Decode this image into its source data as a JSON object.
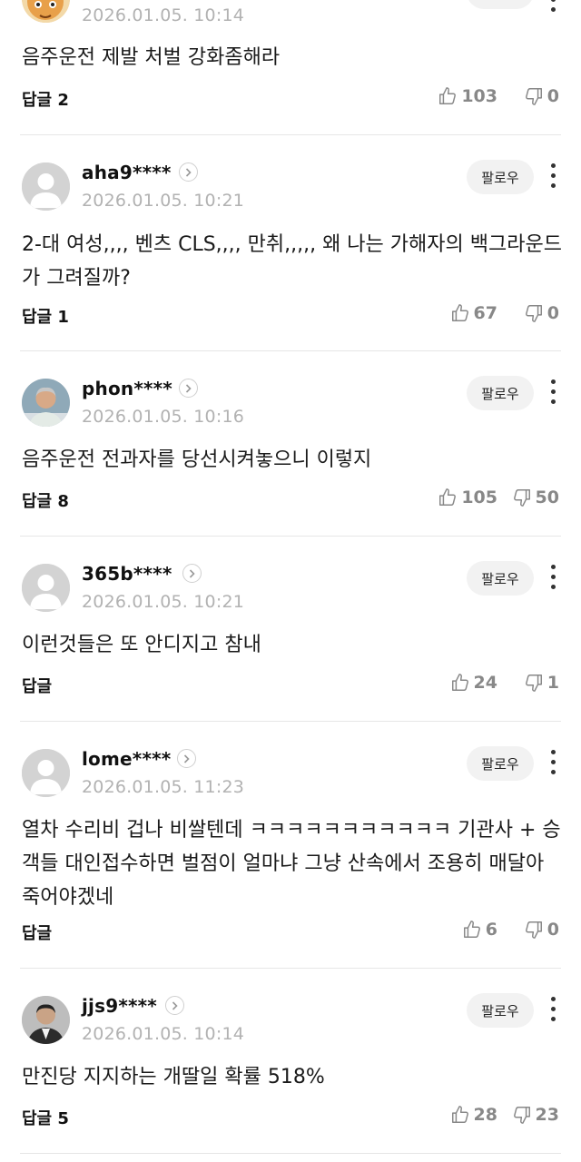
{
  "comments": [
    {
      "username": "",
      "timestamp": "2026.01.05. 10:14",
      "text": "음주운전 제발 처벌 강화좀해라",
      "reply_label": "답글 2",
      "likes": "103",
      "dislikes": "0",
      "follow_label": "",
      "avatar": "cartoon-character"
    },
    {
      "username": "aha9****",
      "timestamp": "2026.01.05. 10:21",
      "text": "2-대 여성,,,, 벤츠 CLS,,,, 만취,,,,, 왜 나는 가해자의 백그라운드가 그려질까?",
      "reply_label": "답글 1",
      "likes": "67",
      "dislikes": "0",
      "follow_label": "팔로우",
      "avatar": "default"
    },
    {
      "username": "phon****",
      "timestamp": "2026.01.05. 10:16",
      "text": "음주운전 전과자를 당선시켜놓으니 이렇지",
      "reply_label": "답글 8",
      "likes": "105",
      "dislikes": "50",
      "follow_label": "팔로우",
      "avatar": "photo-man"
    },
    {
      "username": "365b****",
      "timestamp": "2026.01.05. 10:21",
      "text": "이런것들은 또 안디지고 참내",
      "reply_label": "답글",
      "likes": "24",
      "dislikes": "1",
      "follow_label": "팔로우",
      "avatar": "default"
    },
    {
      "username": "lome****",
      "timestamp": "2026.01.05. 11:23",
      "text": "열차 수리비 겁나 비쌀텐데 ㅋㅋㅋㅋㅋㅋㅋㅋㅋㅋㅋ 기관사 + 승객들 대인접수하면 벌점이 얼마냐 그냥 산속에서 조용히 매달아 죽어야겠네",
      "reply_label": "답글",
      "likes": "6",
      "dislikes": "0",
      "follow_label": "팔로우",
      "avatar": "default"
    },
    {
      "username": "jjs9****",
      "timestamp": "2026.01.05. 10:14",
      "text": "만진당 지지하는 개딸일 확률 518%",
      "reply_label": "답글 5",
      "likes": "28",
      "dislikes": "23",
      "follow_label": "팔로우",
      "avatar": "photo-suit"
    }
  ],
  "icons": {
    "like": "thumbs-up-icon",
    "dislike": "thumbs-down-icon",
    "profile_arrow": "chevron-right-icon",
    "more": "more-vertical-icon"
  },
  "colors": {
    "text": "#1a1a1a",
    "muted": "#b2b2b2",
    "count": "#888888",
    "follow_bg": "#f2f2f2",
    "divider": "#e6e6e6"
  }
}
